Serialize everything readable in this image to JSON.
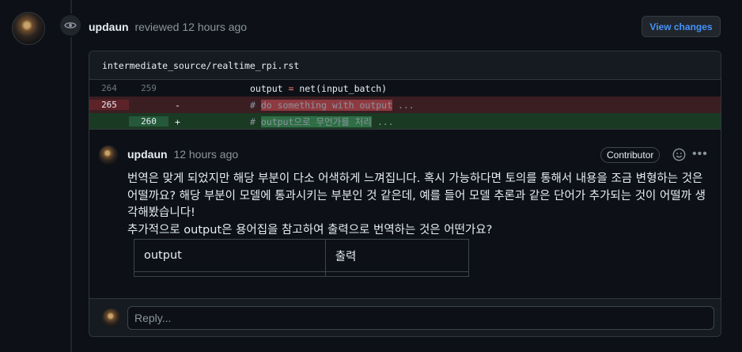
{
  "review": {
    "author": "updaun",
    "action": "reviewed",
    "time": "12 hours ago",
    "view_changes_label": "View changes"
  },
  "file": {
    "path": "intermediate_source/realtime_rpi.rst"
  },
  "diff": [
    {
      "type": "context",
      "old": "264",
      "new": "259",
      "marker": "",
      "code": "output = net(input_batch)"
    },
    {
      "type": "deletion",
      "old": "265",
      "new": "",
      "marker": "-",
      "prefix": "# ",
      "highlight": "do something with output",
      "suffix": " ..."
    },
    {
      "type": "addition",
      "old": "",
      "new": "260",
      "marker": "+",
      "prefix": "# ",
      "highlight": "output으로 무언가를 처리",
      "suffix": " ..."
    }
  ],
  "comment": {
    "author": "updaun",
    "time": "12 hours ago",
    "badge": "Contributor",
    "body_line1": "번역은 맞게 되었지만 해당 부분이 다소 어색하게 느껴집니다. 혹시 가능하다면 토의를 통해서 내용을 조금 변형하는 것은 어떨까요? 해당 부분이 모델에 통과시키는 부분인 것 같은데, 예를 들어 모델 추론과 같은 단어가 추가되는 것이 어떨까 생각해봤습니다!",
    "body_line2": "추가적으로 output은 용어집을 참고하여 출력으로 번역하는 것은 어떤가요?",
    "table": {
      "col1": "output",
      "col2": "출력"
    }
  },
  "reply": {
    "placeholder": "Reply..."
  },
  "colors": {
    "background": "#0d1117",
    "link": "#4493f8",
    "deletion": "#3a1e22",
    "addition": "#1b3a24"
  }
}
